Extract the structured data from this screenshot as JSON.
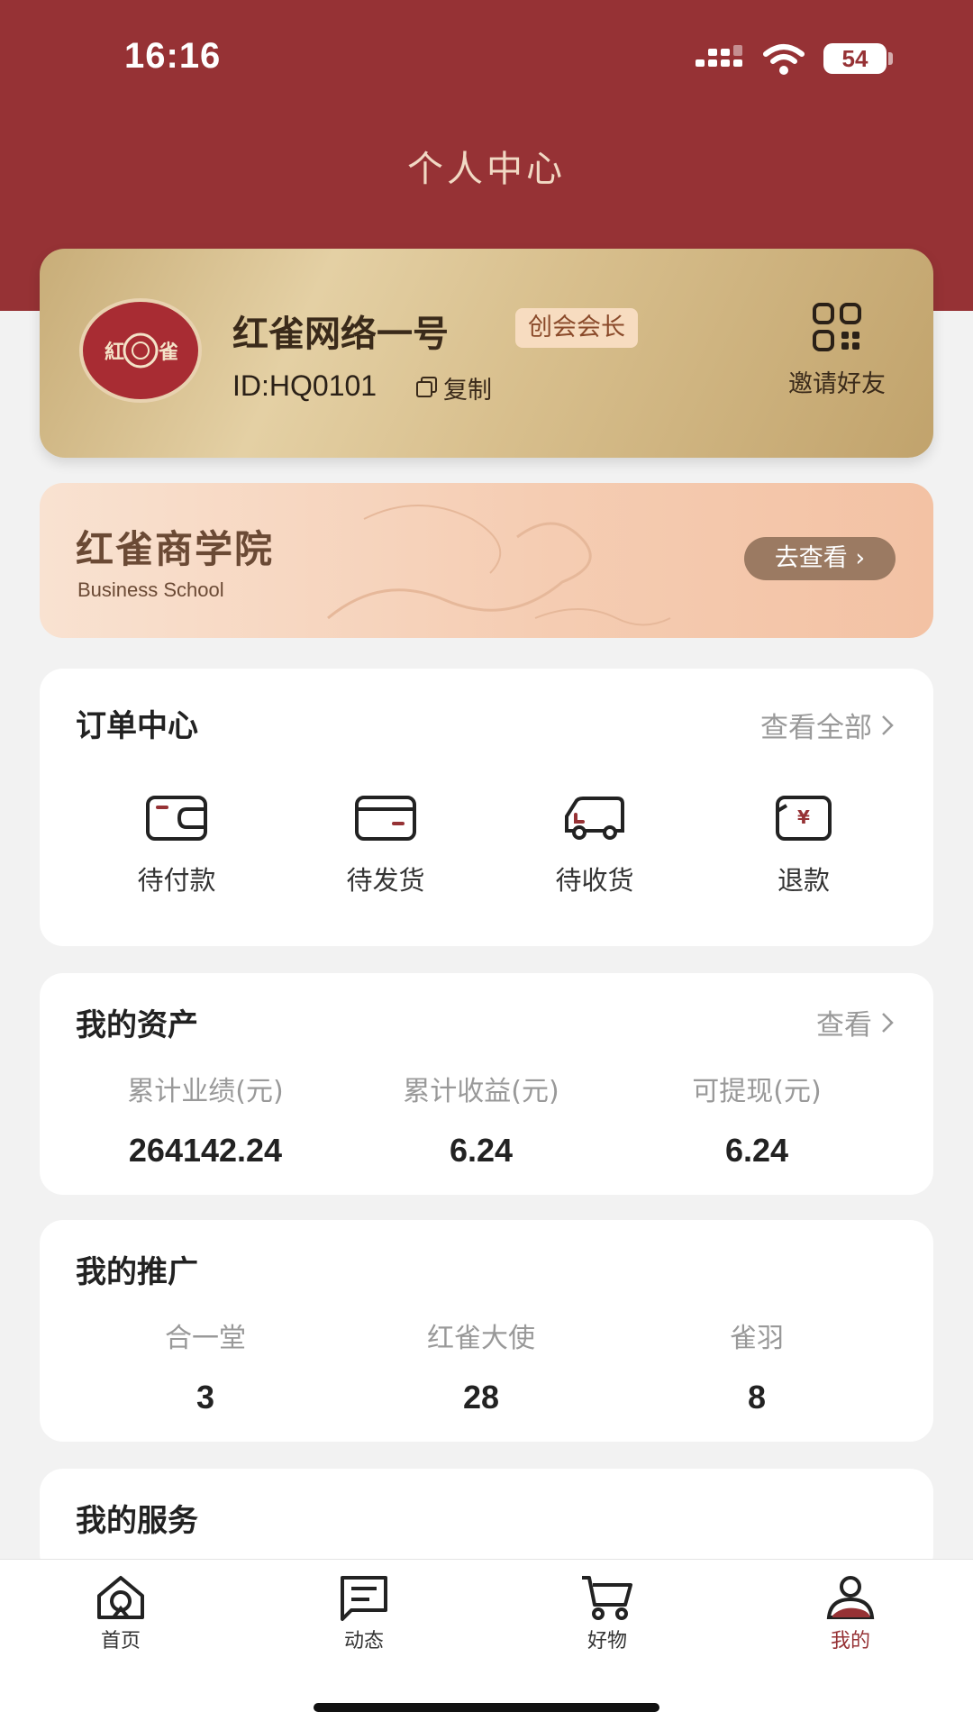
{
  "status_bar": {
    "time": "16:16",
    "battery": "54"
  },
  "header": {
    "title": "个人中心"
  },
  "profile": {
    "avatar_text": "紅雀",
    "name": "红雀网络一号",
    "role_badge": "创会会长",
    "user_id": "ID:HQ0101",
    "copy_label": "复制",
    "invite_label": "邀请好友"
  },
  "school_banner": {
    "title": "红雀商学院",
    "subtitle": "Business School",
    "button_label": "去查看 ›"
  },
  "orders": {
    "title": "订单中心",
    "view_all_label": "查看全部",
    "items": [
      {
        "label": "待付款",
        "icon": "wallet-icon"
      },
      {
        "label": "待发货",
        "icon": "card-icon"
      },
      {
        "label": "待收货",
        "icon": "truck-icon"
      },
      {
        "label": "退款",
        "icon": "refund-icon"
      }
    ]
  },
  "assets": {
    "title": "我的资产",
    "view_label": "查看",
    "stats": [
      {
        "label": "累计业绩(元)",
        "value": "264142.24"
      },
      {
        "label": "累计收益(元)",
        "value": "6.24"
      },
      {
        "label": "可提现(元)",
        "value": "6.24"
      }
    ]
  },
  "promotion": {
    "title": "我的推广",
    "stats": [
      {
        "label": "合一堂",
        "value": "3"
      },
      {
        "label": "红雀大使",
        "value": "28"
      },
      {
        "label": "雀羽",
        "value": "8"
      }
    ]
  },
  "services": {
    "title": "我的服务"
  },
  "tab_bar": {
    "active": "我的",
    "tabs": [
      {
        "label": "首页",
        "icon": "home-icon"
      },
      {
        "label": "动态",
        "icon": "message-icon"
      },
      {
        "label": "好物",
        "icon": "cart-icon"
      },
      {
        "label": "我的",
        "icon": "user-icon"
      }
    ]
  },
  "colors": {
    "brand_red": "#963235",
    "gold_card": "#d8bf8d",
    "banner_peach": "#f5cdb3",
    "badge_bg": "#f7dcc0"
  }
}
